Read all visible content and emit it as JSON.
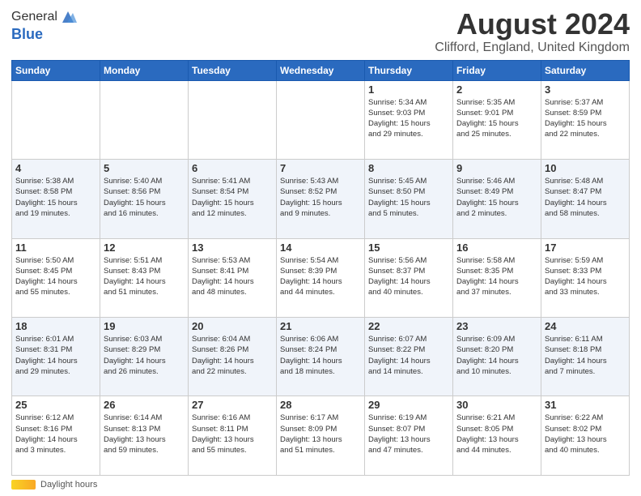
{
  "header": {
    "logo_general": "General",
    "logo_blue": "Blue",
    "month_title": "August 2024",
    "location": "Clifford, England, United Kingdom"
  },
  "weekdays": [
    "Sunday",
    "Monday",
    "Tuesday",
    "Wednesday",
    "Thursday",
    "Friday",
    "Saturday"
  ],
  "weeks": [
    [
      {
        "day": "",
        "info": ""
      },
      {
        "day": "",
        "info": ""
      },
      {
        "day": "",
        "info": ""
      },
      {
        "day": "",
        "info": ""
      },
      {
        "day": "1",
        "info": "Sunrise: 5:34 AM\nSunset: 9:03 PM\nDaylight: 15 hours\nand 29 minutes."
      },
      {
        "day": "2",
        "info": "Sunrise: 5:35 AM\nSunset: 9:01 PM\nDaylight: 15 hours\nand 25 minutes."
      },
      {
        "day": "3",
        "info": "Sunrise: 5:37 AM\nSunset: 8:59 PM\nDaylight: 15 hours\nand 22 minutes."
      }
    ],
    [
      {
        "day": "4",
        "info": "Sunrise: 5:38 AM\nSunset: 8:58 PM\nDaylight: 15 hours\nand 19 minutes."
      },
      {
        "day": "5",
        "info": "Sunrise: 5:40 AM\nSunset: 8:56 PM\nDaylight: 15 hours\nand 16 minutes."
      },
      {
        "day": "6",
        "info": "Sunrise: 5:41 AM\nSunset: 8:54 PM\nDaylight: 15 hours\nand 12 minutes."
      },
      {
        "day": "7",
        "info": "Sunrise: 5:43 AM\nSunset: 8:52 PM\nDaylight: 15 hours\nand 9 minutes."
      },
      {
        "day": "8",
        "info": "Sunrise: 5:45 AM\nSunset: 8:50 PM\nDaylight: 15 hours\nand 5 minutes."
      },
      {
        "day": "9",
        "info": "Sunrise: 5:46 AM\nSunset: 8:49 PM\nDaylight: 15 hours\nand 2 minutes."
      },
      {
        "day": "10",
        "info": "Sunrise: 5:48 AM\nSunset: 8:47 PM\nDaylight: 14 hours\nand 58 minutes."
      }
    ],
    [
      {
        "day": "11",
        "info": "Sunrise: 5:50 AM\nSunset: 8:45 PM\nDaylight: 14 hours\nand 55 minutes."
      },
      {
        "day": "12",
        "info": "Sunrise: 5:51 AM\nSunset: 8:43 PM\nDaylight: 14 hours\nand 51 minutes."
      },
      {
        "day": "13",
        "info": "Sunrise: 5:53 AM\nSunset: 8:41 PM\nDaylight: 14 hours\nand 48 minutes."
      },
      {
        "day": "14",
        "info": "Sunrise: 5:54 AM\nSunset: 8:39 PM\nDaylight: 14 hours\nand 44 minutes."
      },
      {
        "day": "15",
        "info": "Sunrise: 5:56 AM\nSunset: 8:37 PM\nDaylight: 14 hours\nand 40 minutes."
      },
      {
        "day": "16",
        "info": "Sunrise: 5:58 AM\nSunset: 8:35 PM\nDaylight: 14 hours\nand 37 minutes."
      },
      {
        "day": "17",
        "info": "Sunrise: 5:59 AM\nSunset: 8:33 PM\nDaylight: 14 hours\nand 33 minutes."
      }
    ],
    [
      {
        "day": "18",
        "info": "Sunrise: 6:01 AM\nSunset: 8:31 PM\nDaylight: 14 hours\nand 29 minutes."
      },
      {
        "day": "19",
        "info": "Sunrise: 6:03 AM\nSunset: 8:29 PM\nDaylight: 14 hours\nand 26 minutes."
      },
      {
        "day": "20",
        "info": "Sunrise: 6:04 AM\nSunset: 8:26 PM\nDaylight: 14 hours\nand 22 minutes."
      },
      {
        "day": "21",
        "info": "Sunrise: 6:06 AM\nSunset: 8:24 PM\nDaylight: 14 hours\nand 18 minutes."
      },
      {
        "day": "22",
        "info": "Sunrise: 6:07 AM\nSunset: 8:22 PM\nDaylight: 14 hours\nand 14 minutes."
      },
      {
        "day": "23",
        "info": "Sunrise: 6:09 AM\nSunset: 8:20 PM\nDaylight: 14 hours\nand 10 minutes."
      },
      {
        "day": "24",
        "info": "Sunrise: 6:11 AM\nSunset: 8:18 PM\nDaylight: 14 hours\nand 7 minutes."
      }
    ],
    [
      {
        "day": "25",
        "info": "Sunrise: 6:12 AM\nSunset: 8:16 PM\nDaylight: 14 hours\nand 3 minutes."
      },
      {
        "day": "26",
        "info": "Sunrise: 6:14 AM\nSunset: 8:13 PM\nDaylight: 13 hours\nand 59 minutes."
      },
      {
        "day": "27",
        "info": "Sunrise: 6:16 AM\nSunset: 8:11 PM\nDaylight: 13 hours\nand 55 minutes."
      },
      {
        "day": "28",
        "info": "Sunrise: 6:17 AM\nSunset: 8:09 PM\nDaylight: 13 hours\nand 51 minutes."
      },
      {
        "day": "29",
        "info": "Sunrise: 6:19 AM\nSunset: 8:07 PM\nDaylight: 13 hours\nand 47 minutes."
      },
      {
        "day": "30",
        "info": "Sunrise: 6:21 AM\nSunset: 8:05 PM\nDaylight: 13 hours\nand 44 minutes."
      },
      {
        "day": "31",
        "info": "Sunrise: 6:22 AM\nSunset: 8:02 PM\nDaylight: 13 hours\nand 40 minutes."
      }
    ]
  ],
  "footer": {
    "daylight_label": "Daylight hours"
  }
}
